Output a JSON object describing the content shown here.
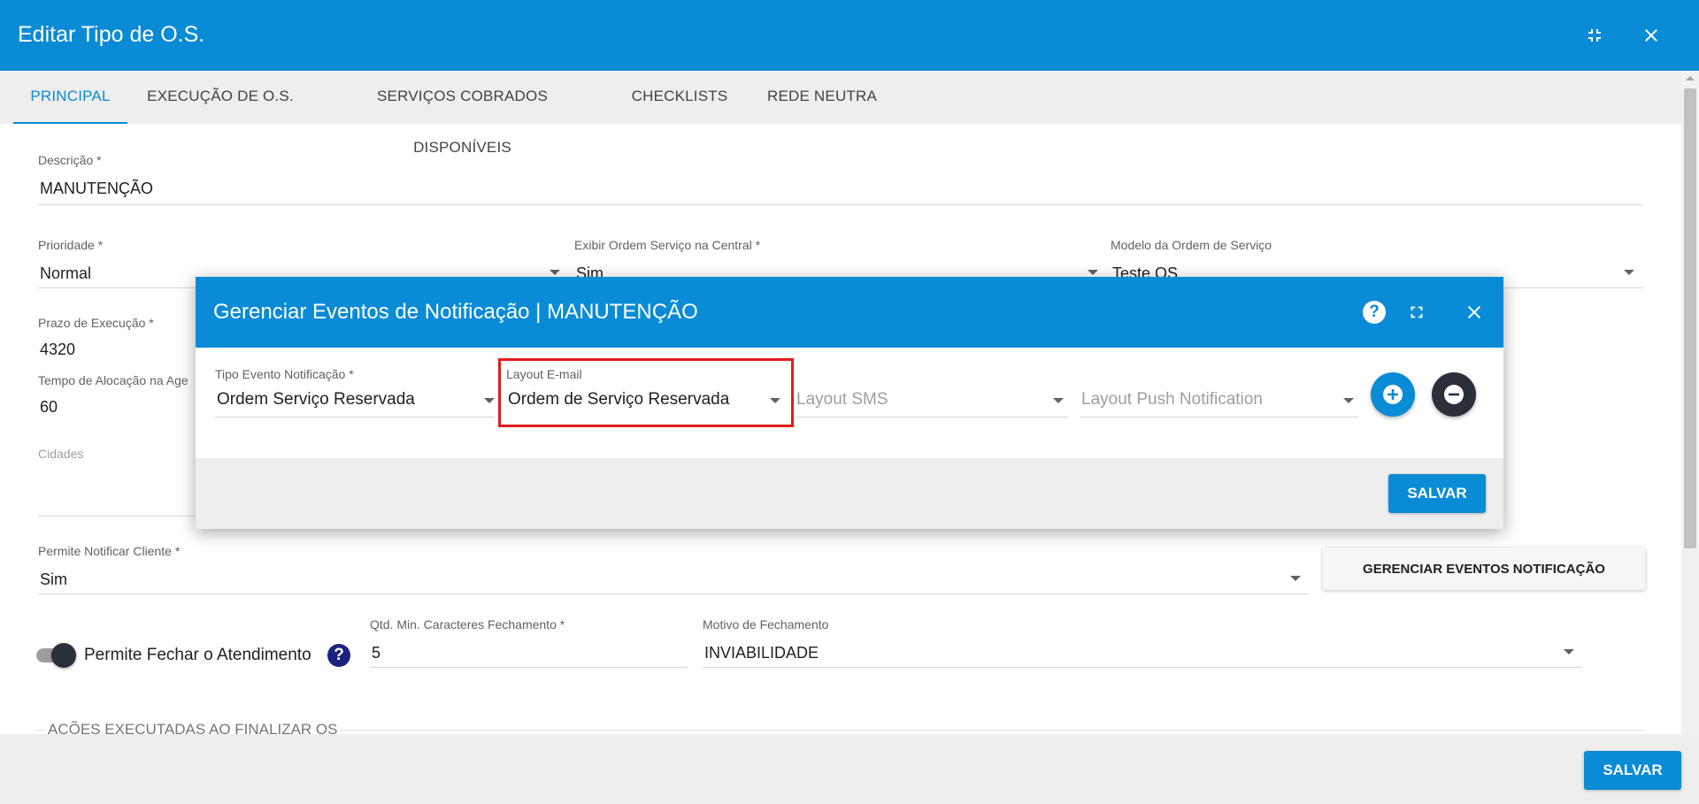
{
  "window": {
    "title": "Editar Tipo de O.S.",
    "colors": {
      "primary": "#0a8bd6",
      "highlight": "#e31b1b"
    }
  },
  "tabs": [
    {
      "label": "PRINCIPAL"
    },
    {
      "label": "EXECUÇÃO DE O.S."
    },
    {
      "label": "SERVIÇOS COBRADOS DISPONÍVEIS"
    },
    {
      "label": "CHECKLISTS"
    },
    {
      "label": "REDE NEUTRA"
    }
  ],
  "form": {
    "descricao": {
      "label": "Descrição",
      "value": "MANUTENÇÃO"
    },
    "prioridade": {
      "label": "Prioridade",
      "value": "Normal"
    },
    "exibir_ordem": {
      "label": "Exibir Ordem Serviço na Central",
      "value": "Sim"
    },
    "modelo_ordem": {
      "label": "Modelo da Ordem de Serviço",
      "value": "Teste OS"
    },
    "prazo_execucao": {
      "label": "Prazo de Execução",
      "value": "4320"
    },
    "tempo_alocacao": {
      "label": "Tempo de Alocação na Age",
      "value": "60"
    },
    "cidades": {
      "label": "Cidades"
    },
    "permite_notificar": {
      "label": "Permite Notificar Cliente",
      "value": "Sim"
    },
    "gerenciar_eventos_label": "GERENCIAR EVENTOS NOTIFICAÇÃO",
    "permite_fechar": {
      "label": "Permite Fechar o Atendimento",
      "help": "?"
    },
    "qtd_min_caracteres": {
      "label": "Qtd. Min. Caracteres Fechamento",
      "value": "5"
    },
    "motivo_fechamento": {
      "label": "Motivo de Fechamento",
      "value": "INVIABILIDADE"
    },
    "acoes_section": "AÇÕES EXECUTADAS AO FINALIZAR OS",
    "required_mark": "*"
  },
  "footer": {
    "save_label": "SALVAR"
  },
  "dialog": {
    "title": "Gerenciar Eventos de Notificação | MANUTENÇÃO",
    "help": "?",
    "fields": {
      "tipo_evento": {
        "label": "Tipo Evento Notificação",
        "value": "Ordem Serviço Reservada"
      },
      "layout_email": {
        "label": "Layout E-mail",
        "value": "Ordem de Serviço Reservada"
      },
      "layout_sms": {
        "placeholder": "Layout SMS"
      },
      "layout_push": {
        "placeholder": "Layout Push Notification"
      }
    },
    "save_label": "SALVAR"
  }
}
